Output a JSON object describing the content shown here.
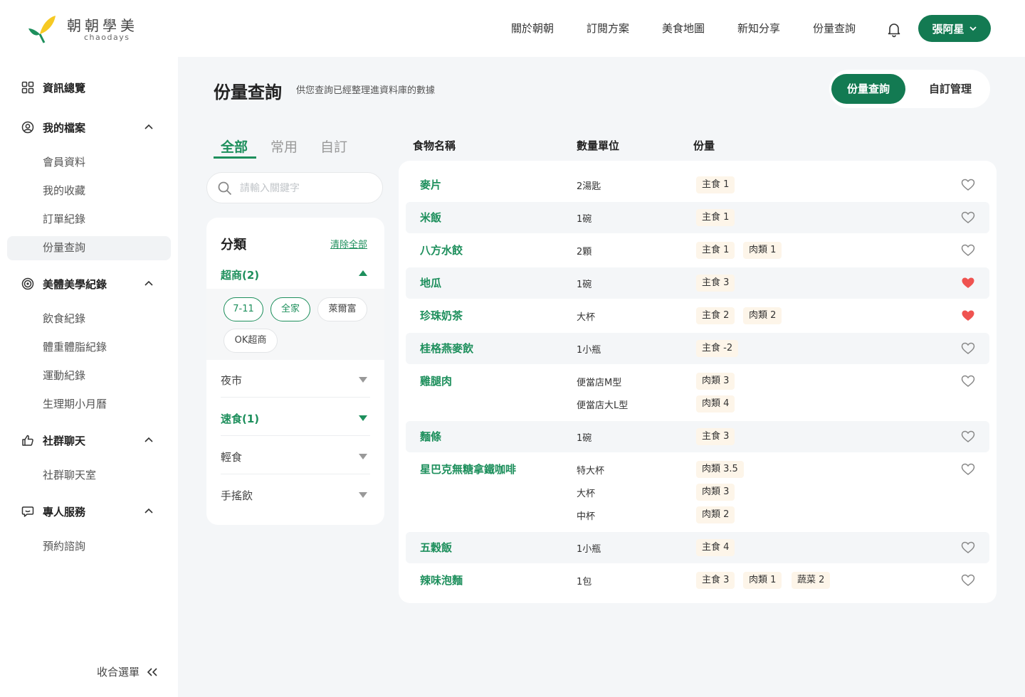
{
  "brand": {
    "name": "朝朝學美",
    "sub": "chaodays"
  },
  "topnav": [
    "關於朝朝",
    "訂閱方案",
    "美食地圖",
    "新知分享",
    "份量查詢"
  ],
  "user": {
    "name": "張阿星"
  },
  "sidebar": {
    "groups": [
      {
        "label": "資訊總覽",
        "icon": "grid-icon",
        "items": []
      },
      {
        "label": "我的檔案",
        "icon": "user-circle-icon",
        "items": [
          "會員資料",
          "我的收藏",
          "訂單紀錄",
          "份量查詢"
        ]
      },
      {
        "label": "美體美學紀錄",
        "icon": "spiral-icon",
        "items": [
          "飲食紀錄",
          "體重體脂紀錄",
          "運動紀錄",
          "生理期小月曆"
        ]
      },
      {
        "label": "社群聊天",
        "icon": "thumbs-up-icon",
        "items": [
          "社群聊天室"
        ]
      },
      {
        "label": "專人服務",
        "icon": "chat-icon",
        "items": [
          "預約諮詢"
        ]
      }
    ],
    "active_item": "份量查詢",
    "collapse_label": "收合選單"
  },
  "page": {
    "title": "份量查詢",
    "subtitle": "供您查詢已經整理進資料庫的數據"
  },
  "segment": [
    "份量查詢",
    "自訂管理"
  ],
  "tabs": [
    "全部",
    "常用",
    "自訂"
  ],
  "search": {
    "placeholder": "請輸入關鍵字",
    "value": ""
  },
  "filter": {
    "title": "分類",
    "clear": "清除全部",
    "categories": [
      "超商(2)",
      "夜市",
      "速食(1)",
      "輕食",
      "手搖飲"
    ],
    "chips": [
      {
        "label": "7-11",
        "selected": true
      },
      {
        "label": "全家",
        "selected": true
      },
      {
        "label": "萊爾富",
        "selected": false
      },
      {
        "label": "OK超商",
        "selected": false
      }
    ]
  },
  "table": {
    "headers": [
      "食物名稱",
      "數量單位",
      "份量"
    ],
    "rows": [
      {
        "name": "麥片",
        "units": [
          {
            "unit": "2湯匙",
            "tags": [
              "主食 1"
            ]
          }
        ],
        "fav": false
      },
      {
        "name": "米飯",
        "units": [
          {
            "unit": "1碗",
            "tags": [
              "主食 1"
            ]
          }
        ],
        "fav": false
      },
      {
        "name": "八方水餃",
        "units": [
          {
            "unit": "2顆",
            "tags": [
              "主食 1",
              "肉類 1"
            ]
          }
        ],
        "fav": false
      },
      {
        "name": "地瓜",
        "units": [
          {
            "unit": "1碗",
            "tags": [
              "主食 3"
            ]
          }
        ],
        "fav": true
      },
      {
        "name": "珍珠奶茶",
        "units": [
          {
            "unit": "大杯",
            "tags": [
              "主食 2",
              "肉類 2"
            ]
          }
        ],
        "fav": true
      },
      {
        "name": "桂格燕麥飲",
        "units": [
          {
            "unit": "1小瓶",
            "tags": [
              "主食 -2"
            ]
          }
        ],
        "fav": false
      },
      {
        "name": "雞腿肉",
        "units": [
          {
            "unit": "便當店M型",
            "tags": [
              "肉類 3"
            ]
          },
          {
            "unit": "便當店大L型",
            "tags": [
              "肉類 4"
            ]
          }
        ],
        "fav": false
      },
      {
        "name": "麵條",
        "units": [
          {
            "unit": "1碗",
            "tags": [
              "主食 3"
            ]
          }
        ],
        "fav": false
      },
      {
        "name": "星巴克無糖拿鐵咖啡",
        "units": [
          {
            "unit": "特大杯",
            "tags": [
              "肉類 3.5"
            ]
          },
          {
            "unit": "大杯",
            "tags": [
              "肉類 3"
            ]
          },
          {
            "unit": "中杯",
            "tags": [
              "肉類 2"
            ]
          }
        ],
        "fav": false
      },
      {
        "name": "五穀飯",
        "units": [
          {
            "unit": "1小瓶",
            "tags": [
              "主食 4"
            ]
          }
        ],
        "fav": false
      },
      {
        "name": "辣味泡麵",
        "units": [
          {
            "unit": "1包",
            "tags": [
              "主食 3",
              "肉類 1",
              "蔬菜 2"
            ]
          }
        ],
        "fav": false
      }
    ]
  },
  "colors": {
    "primary": "#137a52",
    "accent_text": "#1d8f5c",
    "heart_filled": "#ef5350",
    "tag_bg": "#fdf5e9"
  }
}
